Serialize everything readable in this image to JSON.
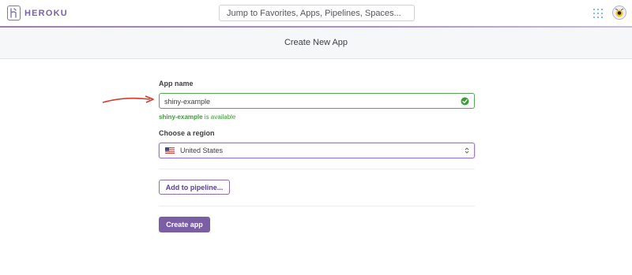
{
  "nav": {
    "brand": "HEROKU",
    "search_placeholder": "Jump to Favorites, Apps, Pipelines, Spaces...",
    "icons": [
      "heroku-logo-icon",
      "apps-grid-icon",
      "user-avatar"
    ]
  },
  "header": {
    "title": "Create New App"
  },
  "form": {
    "app_name_label": "App name",
    "app_name_value": "shiny-example",
    "availability_name": "shiny-example",
    "availability_suffix": " is available",
    "region_label": "Choose a region",
    "region_value": "United States",
    "pipeline_button": "Add to pipeline...",
    "create_button": "Create app"
  },
  "colors": {
    "brand_purple": "#7b5fa5",
    "valid_green": "#56a653",
    "annotation_red": "#d33a2c"
  }
}
